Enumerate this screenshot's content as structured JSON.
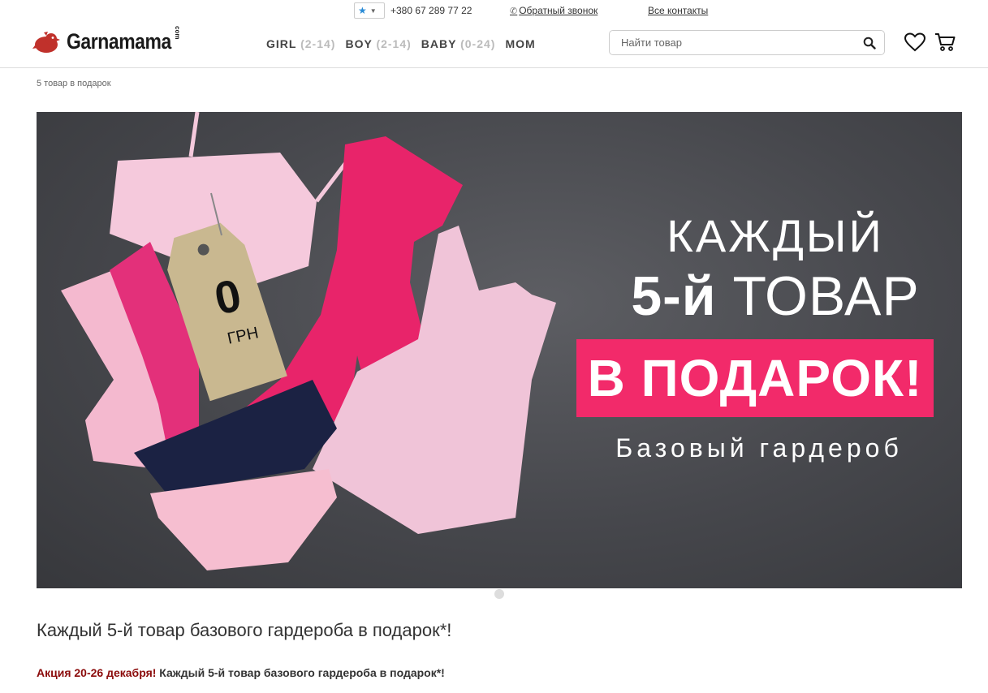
{
  "topbar": {
    "phone": "+380 67 289 77 22",
    "callback_label": "Обратный звонок",
    "contacts_label": "Все контакты"
  },
  "header": {
    "logo_text": "Garnamama",
    "logo_suffix": "com",
    "nav": [
      {
        "label": "GIRL",
        "age": "(2-14)"
      },
      {
        "label": "BOY",
        "age": "(2-14)"
      },
      {
        "label": "BABY",
        "age": "(0-24)"
      },
      {
        "label": "MOM",
        "age": ""
      }
    ],
    "search_placeholder": "Найти товар"
  },
  "breadcrumb": "5 товар в подарок",
  "banner": {
    "line1": "КАЖДЫЙ",
    "line2_bold": "5-й",
    "line2_rest": "ТОВАР",
    "box": "В ПОДАРОК!",
    "sub": "Базовый гардероб",
    "tag_value": "0",
    "tag_currency": "ГРН",
    "accent_color": "#f22a6a"
  },
  "promo": {
    "title": "Каждый 5-й товар базового гардероба в подарок*!",
    "line_red": "Акция 20-26 декабря!",
    "line_rest": "Каждый 5-й товар базового гардероба в подарок*!"
  }
}
